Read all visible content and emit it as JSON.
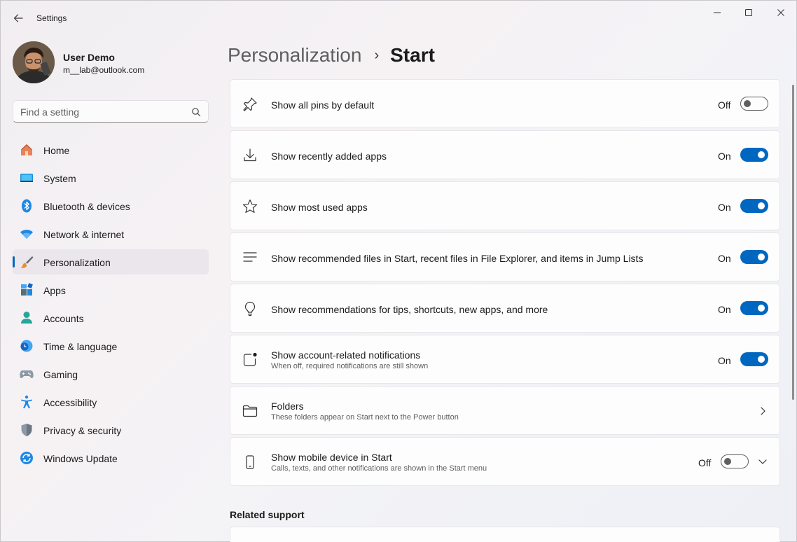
{
  "window": {
    "title": "Settings"
  },
  "user": {
    "name": "User Demo",
    "email": "m__lab@outlook.com"
  },
  "search": {
    "placeholder": "Find a setting"
  },
  "sidebar": {
    "items": [
      {
        "label": "Home",
        "icon": "home-icon"
      },
      {
        "label": "System",
        "icon": "system-icon"
      },
      {
        "label": "Bluetooth & devices",
        "icon": "bluetooth-icon"
      },
      {
        "label": "Network & internet",
        "icon": "wifi-icon"
      },
      {
        "label": "Personalization",
        "icon": "brush-icon",
        "selected": true
      },
      {
        "label": "Apps",
        "icon": "apps-icon"
      },
      {
        "label": "Accounts",
        "icon": "accounts-icon"
      },
      {
        "label": "Time & language",
        "icon": "clock-globe-icon"
      },
      {
        "label": "Gaming",
        "icon": "gamepad-icon"
      },
      {
        "label": "Accessibility",
        "icon": "accessibility-icon"
      },
      {
        "label": "Privacy & security",
        "icon": "shield-icon"
      },
      {
        "label": "Windows Update",
        "icon": "update-icon"
      }
    ]
  },
  "breadcrumb": {
    "parent": "Personalization",
    "separator": "›",
    "current": "Start"
  },
  "settings": [
    {
      "title": "Show all pins by default",
      "state": "Off",
      "icon": "pin-icon"
    },
    {
      "title": "Show recently added apps",
      "state": "On",
      "icon": "download-icon"
    },
    {
      "title": "Show most used apps",
      "state": "On",
      "icon": "star-icon"
    },
    {
      "title": "Show recommended files in Start, recent files in File Explorer, and items in Jump Lists",
      "state": "On",
      "icon": "list-icon"
    },
    {
      "title": "Show recommendations for tips, shortcuts, new apps, and more",
      "state": "On",
      "icon": "lightbulb-icon"
    },
    {
      "title": "Show account-related notifications",
      "description": "When off, required notifications are still shown",
      "state": "On",
      "icon": "notification-icon"
    },
    {
      "title": "Folders",
      "description": "These folders appear on Start next to the Power button",
      "icon": "folder-icon"
    },
    {
      "title": "Show mobile device in Start",
      "description": "Calls, texts, and other notifications are shown in the Start menu",
      "state": "Off",
      "icon": "phone-icon"
    }
  ],
  "related": {
    "header": "Related support"
  },
  "colors": {
    "accent": "#0067c0"
  }
}
